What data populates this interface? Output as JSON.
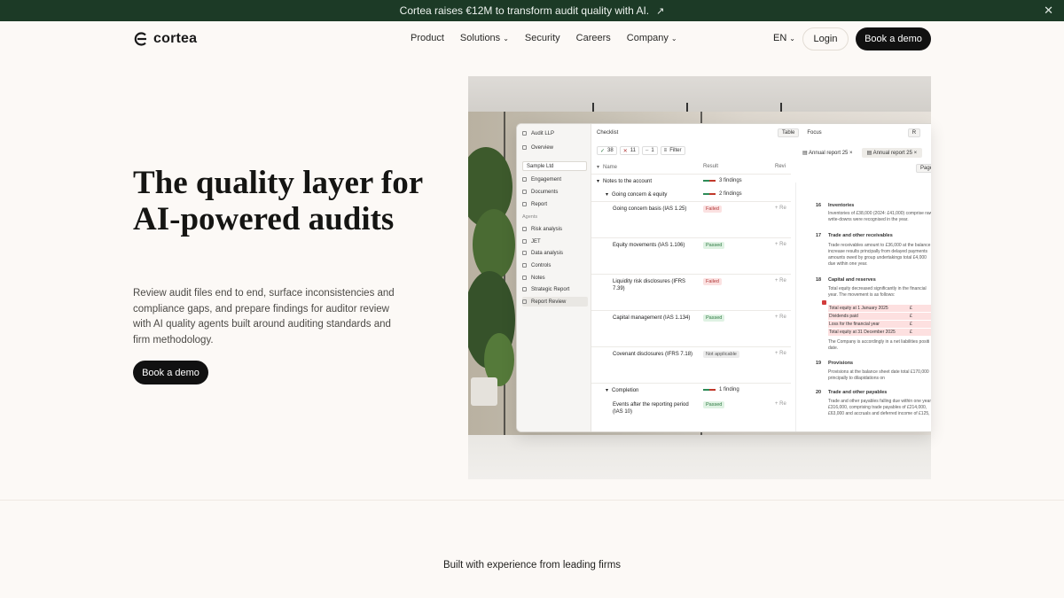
{
  "banner": {
    "text": "Cortea raises €12M to transform audit quality with AI.",
    "arrow": "↗",
    "close": "✕"
  },
  "nav": {
    "logo": "cortea",
    "items": [
      {
        "label": "Product",
        "chevron": ""
      },
      {
        "label": "Solutions",
        "chevron": "⌄"
      },
      {
        "label": "Security",
        "chevron": ""
      },
      {
        "label": "Careers",
        "chevron": ""
      },
      {
        "label": "Company",
        "chevron": "⌄"
      }
    ],
    "lang": "EN",
    "lang_chevron": "⌄",
    "login": "Login",
    "cta": "Book a demo"
  },
  "hero": {
    "title": "The quality layer for AI-powered audits",
    "subtitle": "Review audit files end to end, surface inconsistencies and compliance gaps, and prepare findings for auditor review with AI quality agents built around auditing standards and firm methodology.",
    "cta": "Book a demo"
  },
  "app": {
    "workspace": "Audit LLP",
    "overview": "Overview",
    "client": "Sample Ltd",
    "nav_top": [
      "Engagement",
      "Documents",
      "Report"
    ],
    "agents_header": "Agents",
    "agents": [
      "Risk analysis",
      "JET",
      "Data analysis",
      "Controls",
      "Notes",
      "Strategic Report",
      "Report Review"
    ],
    "checklist_title": "Checklist",
    "counts": {
      "passed": "38",
      "failed": "11",
      "na": "1"
    },
    "filter": "Filter",
    "columns": {
      "name": "Name",
      "result": "Result",
      "review": "Revi"
    },
    "groups": {
      "notes": "Notes to the account",
      "notes_findings": "3 findings",
      "going": "Going concern & equity",
      "going_findings": "2 findings",
      "completion": "Completion",
      "completion_findings": "1 finding"
    },
    "rows": [
      {
        "name": "Going concern basis (IAS 1.25)",
        "result": "Failed"
      },
      {
        "name": "Equity movements (IAS 1.106)",
        "result": "Passed"
      },
      {
        "name": "Liquidity risk disclosures (IFRS 7.39)",
        "result": "Failed"
      },
      {
        "name": "Capital management (IAS 1.134)",
        "result": "Passed"
      },
      {
        "name": "Covenant disclosures (IFRS 7.18)",
        "result": "Not applicable"
      },
      {
        "name": "Events after the reporting period (IAS 10)",
        "result": "Passed"
      }
    ],
    "review_label": "+ Re",
    "toolbar": {
      "table": "Table",
      "focus": "Focus",
      "r": "R"
    },
    "tabs": [
      "Annual report 25",
      "Annual report 25"
    ],
    "page_btn": "Page",
    "doc": {
      "s16": {
        "num": "16",
        "title": "Inventories",
        "text": "Inventories of £38,000 (2024: £41,000) comprise raw write-downs were recognised in the year."
      },
      "s17": {
        "num": "17",
        "title": "Trade and other receivables",
        "text": "Trade receivables amount to £36,000 at the balance increase results principally from delayed payments amounts owed by group undertakings total £4,000 due within one year."
      },
      "s18": {
        "num": "18",
        "title": "Capital and reserves",
        "text": "Total equity decreased significantly in the financial year. The movement is as follows:"
      },
      "hl": [
        "Total equity at 1 January 2025",
        "Dividends paid",
        "Loss for the financial year",
        "Total equity at 31 December 2025"
      ],
      "hl_cur": "£",
      "s18b": "The Company is accordingly in a net liabilities positi date.",
      "s19": {
        "num": "19",
        "title": "Provisions",
        "text": "Provisions at the balance sheet date total £170,000 principally to dilapidations on"
      },
      "s20": {
        "num": "20",
        "title": "Trade and other payables",
        "text": "Trade and other payables falling due within one year £316,000, comprising trade payables of £214,000, £63,000 and accruals and deferred income of £125,"
      }
    }
  },
  "firms": "Built with experience from leading firms"
}
